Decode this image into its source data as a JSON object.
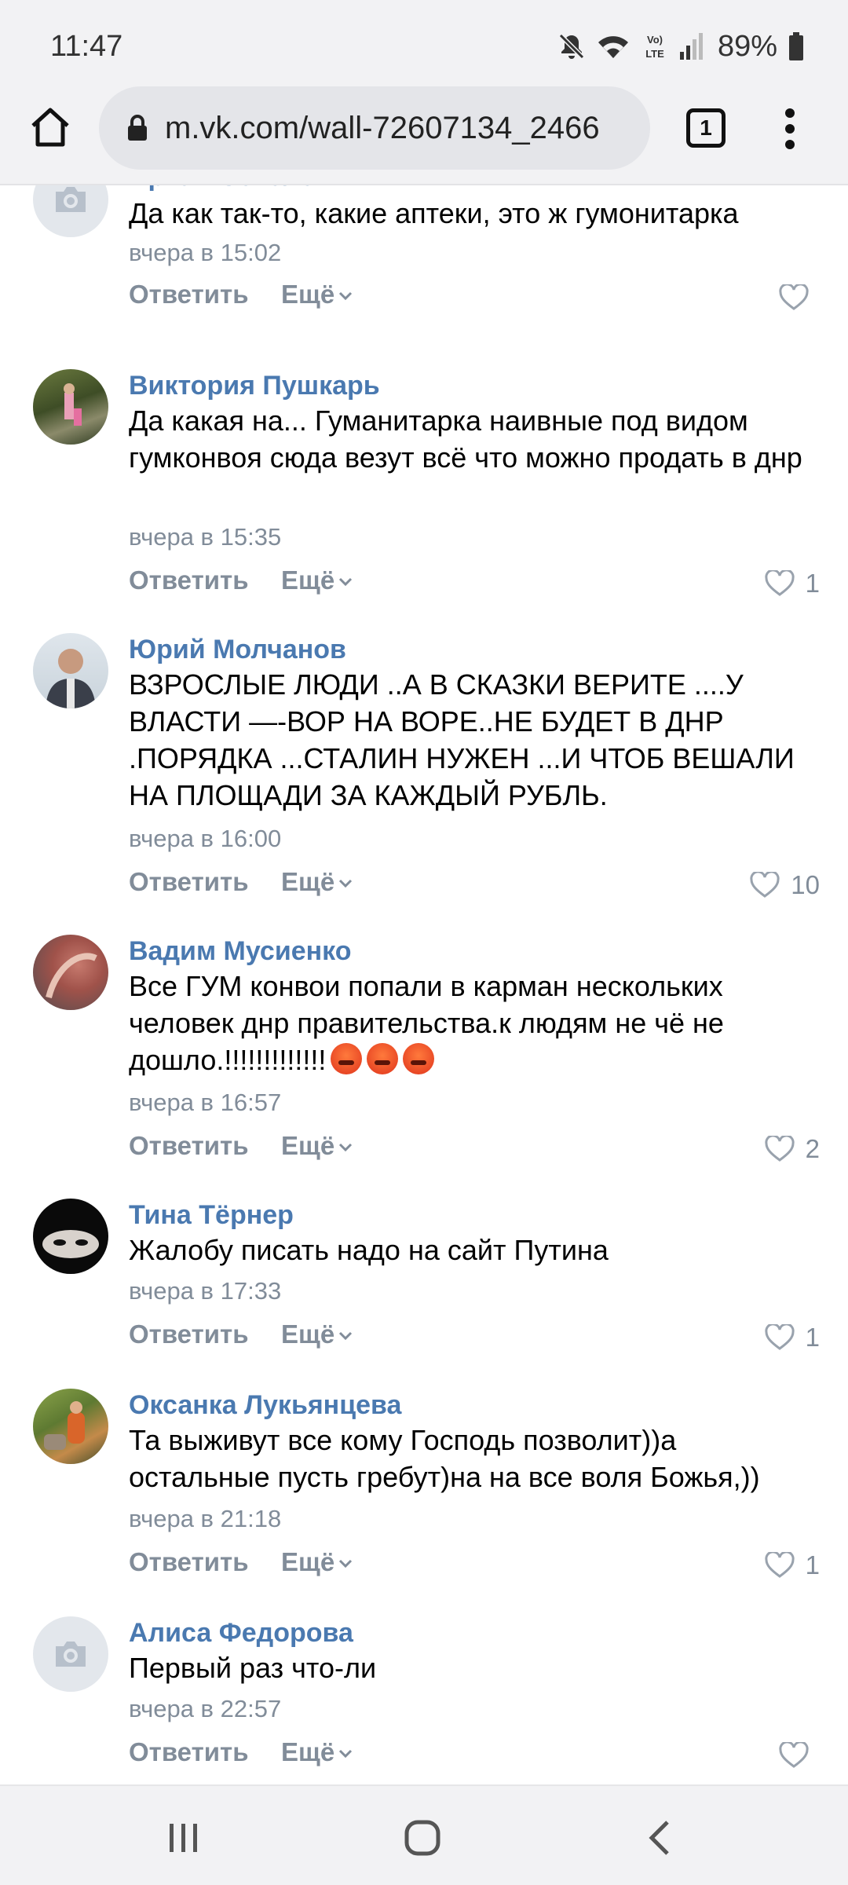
{
  "status": {
    "time": "11:47",
    "battery": "89%"
  },
  "browser": {
    "url": "m.vk.com/wall-72607134_2466",
    "tab_count": "1"
  },
  "comments": [
    {
      "author": "Артем Соколов",
      "text": "Да как так-то, какие аптеки, это ж гумонитарка",
      "date": "вчера в 15:02",
      "reply": "Ответить",
      "more": "Ещё",
      "likes": ""
    },
    {
      "author": "Виктория Пушкарь",
      "text": "Да какая на... Гуманитарка наивные под видом гумконвоя сюда везут всё что можно продать в днр",
      "date": "вчера в 15:35",
      "reply": "Ответить",
      "more": "Ещё",
      "likes": "1"
    },
    {
      "author": "Юрий Молчанов",
      "text": "ВЗРОСЛЫЕ ЛЮДИ ..А В СКАЗКИ ВЕРИТЕ ....У ВЛАСТИ —-ВОР НА ВОРЕ..НЕ БУДЕТ В ДНР .ПОРЯДКА ...СТАЛИН НУЖЕН ...И ЧТОБ ВЕШАЛИ НА ПЛОЩАДИ ЗА КАЖДЫЙ РУБЛЬ.",
      "date": "вчера в 16:00",
      "reply": "Ответить",
      "more": "Ещё",
      "likes": "10"
    },
    {
      "author": "Вадим Мусиенко",
      "text": "Все ГУМ конвои попали в карман нескольких человек днр правительства.к людям не чё не дошло.!!!!!!!!!!!!!",
      "date": "вчера в 16:57",
      "reply": "Ответить",
      "more": "Ещё",
      "likes": "2"
    },
    {
      "author": "Тина Тёрнер",
      "text": "Жалобу писать надо на сайт Путина",
      "date": "вчера в 17:33",
      "reply": "Ответить",
      "more": "Ещё",
      "likes": "1"
    },
    {
      "author": "Оксанка Лукьянцева",
      "text": "Та выживут все кому Господь позволит))а остальные пусть гребут)на на все воля Божья,))",
      "date": "вчера в 21:18",
      "reply": "Ответить",
      "more": "Ещё",
      "likes": "1"
    },
    {
      "author": "Алиса Федорова",
      "text": "Первый раз что-ли",
      "date": "вчера в 22:57",
      "reply": "Ответить",
      "more": "Ещё",
      "likes": ""
    }
  ],
  "colors": {
    "author": "#4a79b0",
    "meta": "#818c99",
    "bar": "#f2f2f4"
  }
}
